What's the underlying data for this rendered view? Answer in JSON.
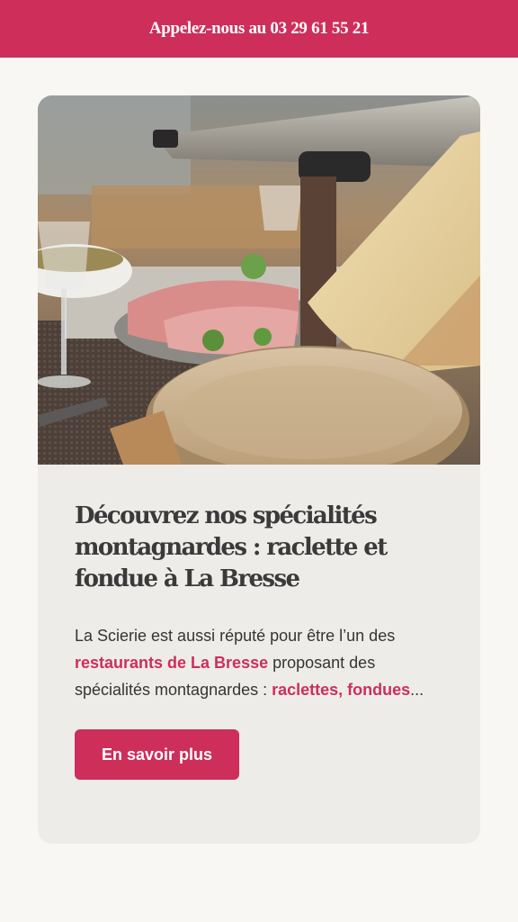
{
  "topbar": {
    "phone_text": "Appelez-nous au 03 29 61 55 21"
  },
  "card": {
    "title": "Découvrez nos spécialités montagnardes : raclette et fondue à La Bresse",
    "paragraph": {
      "part1": "La Scierie est aussi réputé pour être l’un des ",
      "link1": "restaurants de La Bresse",
      "part2": " proposant des spécialités montagnardes : ",
      "link2": "raclettes, fondues",
      "part3": "..."
    },
    "button_label": "En savoir plus"
  },
  "colors": {
    "brand": "#cd2e5a",
    "background": "#f8f7f3",
    "card": "#eeece9",
    "heading": "#3a3a3a"
  }
}
